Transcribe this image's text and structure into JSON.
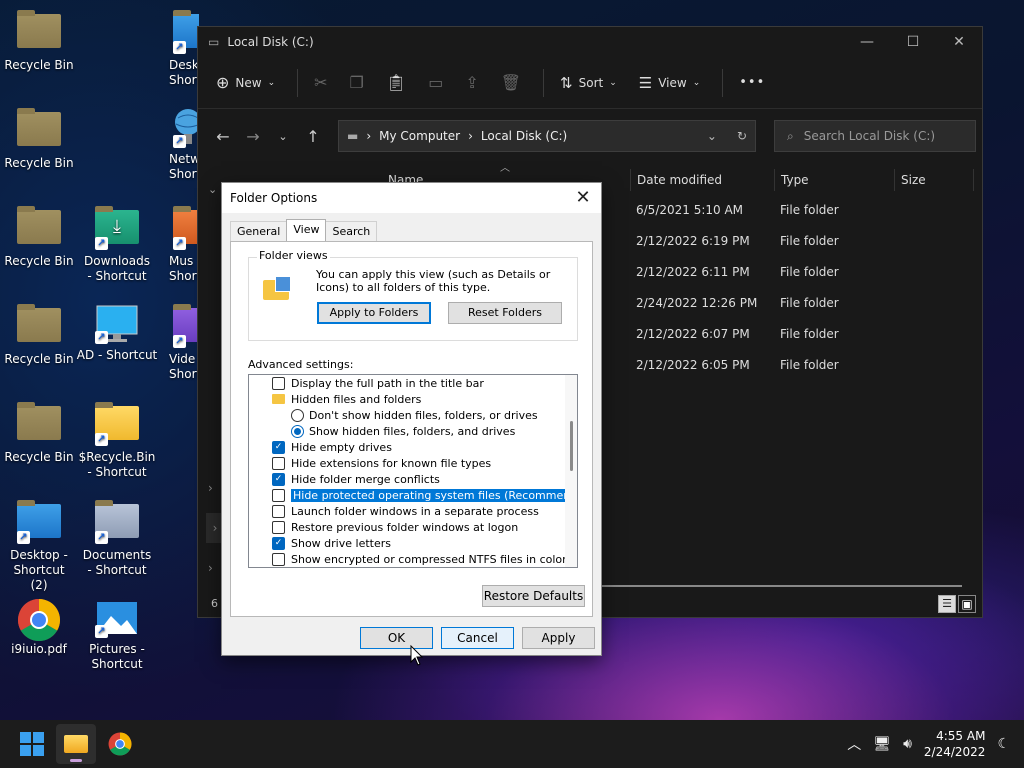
{
  "desktop": {
    "icons": [
      {
        "label": "Recycle Bin"
      },
      {
        "label": "Recycle Bin"
      },
      {
        "label": "Recycle Bin"
      },
      {
        "label": "Recycle Bin"
      },
      {
        "label": "Recycle Bin"
      },
      {
        "label": "Desktop - Shortcut (2)"
      },
      {
        "label": "i9iuio.pdf"
      },
      {
        "label": "Deskt Short"
      },
      {
        "label": "Netw Short"
      },
      {
        "label": "Downloads - Shortcut"
      },
      {
        "label": "Mus Short"
      },
      {
        "label": "AD - Shortcut"
      },
      {
        "label": "Vide Short"
      },
      {
        "label": "$Recycle.Bin - Shortcut"
      },
      {
        "label": "Documents - Shortcut"
      },
      {
        "label": "Pictures - Shortcut"
      }
    ]
  },
  "explorer": {
    "title": "Local Disk (C:)",
    "toolbar": {
      "new": "New",
      "sort": "Sort",
      "view": "View",
      "more": "•••"
    },
    "breadcrumb": [
      "My Computer",
      "Local Disk (C:)"
    ],
    "search_placeholder": "Search Local Disk (C:)",
    "columns": {
      "name": "Name",
      "date": "Date modified",
      "type": "Type",
      "size": "Size"
    },
    "rows": [
      {
        "date": "6/5/2021 5:10 AM",
        "type": "File folder"
      },
      {
        "date": "2/12/2022 6:19 PM",
        "type": "File folder"
      },
      {
        "date": "2/12/2022 6:11 PM",
        "type": "File folder"
      },
      {
        "date": "2/24/2022 12:26 PM",
        "type": "File folder"
      },
      {
        "date": "2/12/2022 6:07 PM",
        "type": "File folder"
      },
      {
        "date": "2/12/2022 6:05 PM",
        "type": "File folder"
      }
    ],
    "status": "6"
  },
  "dialog": {
    "title": "Folder Options",
    "tabs": [
      "General",
      "View",
      "Search"
    ],
    "folder_views": {
      "label": "Folder views",
      "text": "You can apply this view (such as Details or Icons) to all folders of this type.",
      "apply_button": "Apply to Folders",
      "reset_button": "Reset Folders"
    },
    "advanced_label": "Advanced settings:",
    "items": [
      {
        "label": "Display the full path in the title bar",
        "kind": "check",
        "checked": false
      },
      {
        "label": "Hidden files and folders",
        "kind": "folder"
      },
      {
        "label": "Don't show hidden files, folders, or drives",
        "kind": "radio",
        "checked": false
      },
      {
        "label": "Show hidden files, folders, and drives",
        "kind": "radio",
        "checked": true
      },
      {
        "label": "Hide empty drives",
        "kind": "check",
        "checked": true
      },
      {
        "label": "Hide extensions for known file types",
        "kind": "check",
        "checked": false
      },
      {
        "label": "Hide folder merge conflicts",
        "kind": "check",
        "checked": true
      },
      {
        "label": "Hide protected operating system files (Recommended)",
        "kind": "check",
        "checked": false,
        "selected": true
      },
      {
        "label": "Launch folder windows in a separate process",
        "kind": "check",
        "checked": false
      },
      {
        "label": "Restore previous folder windows at logon",
        "kind": "check",
        "checked": false
      },
      {
        "label": "Show drive letters",
        "kind": "check",
        "checked": true
      },
      {
        "label": "Show encrypted or compressed NTFS files in color",
        "kind": "check",
        "checked": false
      }
    ],
    "restore_defaults": "Restore Defaults",
    "ok": "OK",
    "cancel": "Cancel",
    "apply": "Apply"
  },
  "taskbar": {
    "time": "4:55 AM",
    "date": "2/24/2022"
  }
}
